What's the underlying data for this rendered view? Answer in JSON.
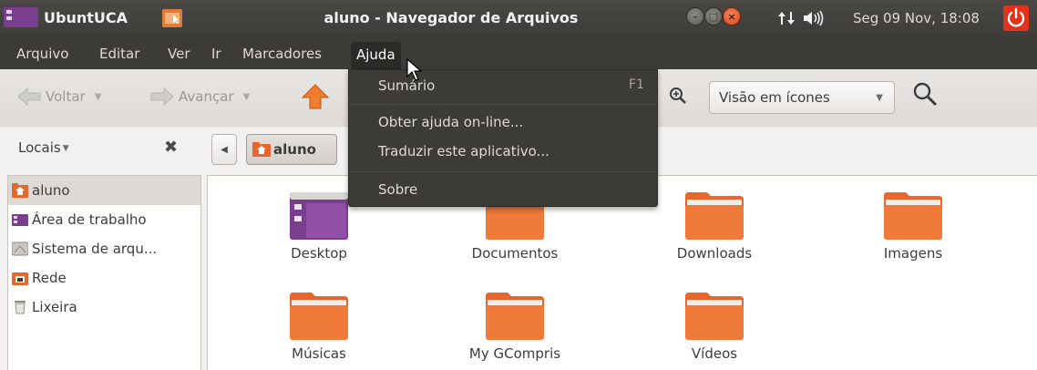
{
  "top_panel": {
    "app_name": "UbuntUCA",
    "window_title": "aluno - Navegador de Arquivos",
    "clock": "Seg 09 Nov, 18:08"
  },
  "menubar": {
    "items": [
      "Arquivo",
      "Editar",
      "Ver",
      "Ir",
      "Marcadores",
      "Ajuda"
    ],
    "active": "Ajuda"
  },
  "toolbar": {
    "back_label": "Voltar",
    "forward_label": "Avançar",
    "view_mode": "Visão em ícones"
  },
  "locbar": {
    "places_label": "Locais",
    "path_current": "aluno"
  },
  "sidebar": {
    "items": [
      {
        "label": "aluno",
        "icon": "home-folder-icon",
        "selected": true
      },
      {
        "label": "Área de trabalho",
        "icon": "desktop-icon"
      },
      {
        "label": "Sistema de arqu...",
        "icon": "drive-icon"
      },
      {
        "label": "Rede",
        "icon": "network-icon"
      },
      {
        "label": "Lixeira",
        "icon": "trash-icon"
      }
    ]
  },
  "files": [
    {
      "label": "Desktop",
      "icon": "desktop-folder-icon"
    },
    {
      "label": "Documentos",
      "icon": "folder-icon"
    },
    {
      "label": "Downloads",
      "icon": "folder-icon"
    },
    {
      "label": "Imagens",
      "icon": "folder-icon"
    },
    {
      "label": "Músicas",
      "icon": "folder-icon"
    },
    {
      "label": "My GCompris",
      "icon": "folder-icon"
    },
    {
      "label": "Vídeos",
      "icon": "folder-icon"
    }
  ],
  "help_menu": {
    "items": [
      {
        "label": "Sumário",
        "accel": "F1"
      },
      {
        "label": "Obter ajuda on-line..."
      },
      {
        "label": "Traduzir este aplicativo..."
      },
      {
        "label": "Sobre"
      }
    ]
  },
  "colors": {
    "panel": "#3c3b37",
    "folder_orange": "#e8652b",
    "close_orange": "#df4a16",
    "power_red": "#e3321c"
  }
}
